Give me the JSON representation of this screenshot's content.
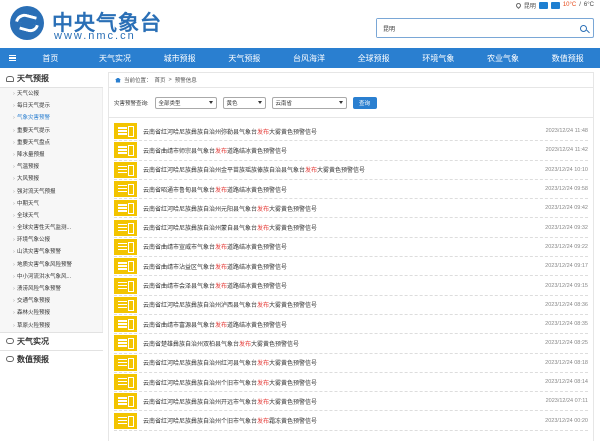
{
  "topbar": {
    "city": "昆明",
    "temp_high": "10°C",
    "sep": "/",
    "temp_low": "6°C"
  },
  "header": {
    "site_name_cn": "中央气象台",
    "site_name_en": "www.nmc.cn",
    "search_value": "昆明"
  },
  "nav": [
    "首页",
    "天气实况",
    "城市预报",
    "天气预报",
    "台风海洋",
    "全球预报",
    "环境气象",
    "农业气象",
    "数值预报"
  ],
  "sidebar": {
    "title": "天气预报",
    "items": [
      "天气公报",
      "每日天气提示",
      "气象灾害预警",
      "重要天气提示",
      "重要天气盘点",
      "降水量预报",
      "气温预报",
      "大风预报",
      "强对流天气预报",
      "中期天气",
      "全球天气",
      "全球灾害性天气监测...",
      "环境气象公报",
      "山洪灾害气象预警",
      "地质灾害气象风险预警",
      "中小河流洪水气象风...",
      "渍涝风险气象预警",
      "交通气象预报",
      "森林火险预报",
      "草原火险预报"
    ],
    "section2": "天气实况",
    "section3": "数值预报"
  },
  "breadcrumb": {
    "prefix": "当前位置：",
    "home": "首页",
    "sep": ">",
    "current": "预警信息"
  },
  "filter": {
    "label": "灾害预警查询:",
    "type": "全部类型",
    "color": "黄色",
    "province": "云南省",
    "button": "查询"
  },
  "alerts": [
    {
      "pre": "云南省红河哈尼族彝族自治州弥勒县气象台",
      "hl": "发布",
      "post": "大雾黄色预警信号",
      "time": "2023/12/24 11:48"
    },
    {
      "pre": "云南省曲靖市师宗县气象台",
      "hl": "发布",
      "post": "道路结冰黄色预警信号",
      "time": "2023/12/24 11:42"
    },
    {
      "pre": "云南省红河哈尼族彝族自治州金平苗族瑶族傣族自治县气象台",
      "hl": "发布",
      "post": "大雾黄色预警信号",
      "time": "2023/12/24 10:10"
    },
    {
      "pre": "云南省昭通市鲁甸县气象台",
      "hl": "发布",
      "post": "道路结冰黄色预警信号",
      "time": "2023/12/24 09:58"
    },
    {
      "pre": "云南省红河哈尼族彝族自治州元阳县气象台",
      "hl": "发布",
      "post": "大雾黄色预警信号",
      "time": "2023/12/24 09:42"
    },
    {
      "pre": "云南省红河哈尼族彝族自治州蒙自县气象台",
      "hl": "发布",
      "post": "大雾黄色预警信号",
      "time": "2023/12/24 09:32"
    },
    {
      "pre": "云南省曲靖市宣威市气象台",
      "hl": "发布",
      "post": "道路结冰黄色预警信号",
      "time": "2023/12/24 09:22"
    },
    {
      "pre": "云南省曲靖市沾益区气象台",
      "hl": "发布",
      "post": "道路结冰黄色预警信号",
      "time": "2023/12/24 09:17"
    },
    {
      "pre": "云南省曲靖市会泽县气象台",
      "hl": "发布",
      "post": "道路结冰黄色预警信号",
      "time": "2023/12/24 09:15"
    },
    {
      "pre": "云南省红河哈尼族彝族自治州泸西县气象台",
      "hl": "发布",
      "post": "大雾黄色预警信号",
      "time": "2023/12/24 08:36"
    },
    {
      "pre": "云南省曲靖市富源县气象台",
      "hl": "发布",
      "post": "道路结冰黄色预警信号",
      "time": "2023/12/24 08:35"
    },
    {
      "pre": "云南省楚雄彝族自治州双柏县气象台",
      "hl": "发布",
      "post": "大雾黄色预警信号",
      "time": "2023/12/24 08:25"
    },
    {
      "pre": "云南省红河哈尼族彝族自治州红河县气象台",
      "hl": "发布",
      "post": "大雾黄色预警信号",
      "time": "2023/12/24 08:18"
    },
    {
      "pre": "云南省红河哈尼族彝族自治州个旧市气象台",
      "hl": "发布",
      "post": "大雾黄色预警信号",
      "time": "2023/12/24 08:14"
    },
    {
      "pre": "云南省红河哈尼族彝族自治州开远市气象台",
      "hl": "发布",
      "post": "大雾黄色预警信号",
      "time": "2023/12/24 07:11"
    },
    {
      "pre": "云南省红河哈尼族彝族自治州个旧市气象台",
      "hl": "发布",
      "post": "霜冻黄色预警信号",
      "time": "2023/12/24 00:20"
    }
  ],
  "colors": {
    "brand": "#2a6fb6",
    "nav": "#2a7fd0",
    "warning_yellow": "#f3c400",
    "highlight": "#e53935"
  }
}
